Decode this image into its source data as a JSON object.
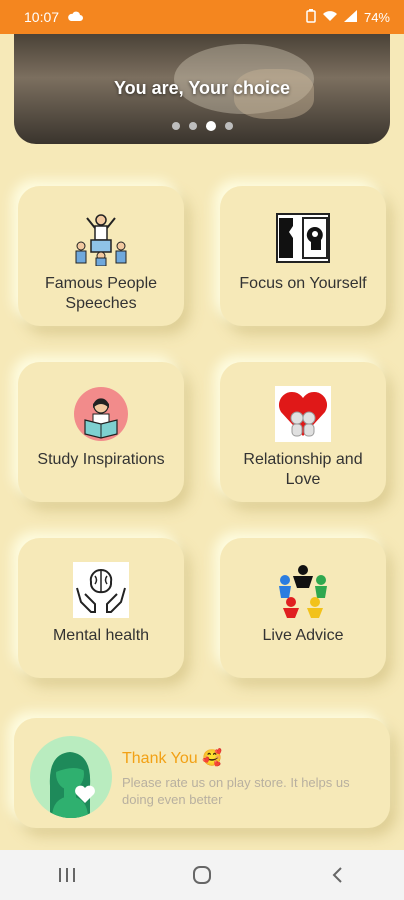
{
  "status": {
    "time": "10:07",
    "battery": "74%"
  },
  "banner": {
    "caption": "You are, Your choice",
    "dot_count": 4,
    "active_dot": 2
  },
  "categories": [
    {
      "label": "Famous People Speeches",
      "icon": "people-speech-icon"
    },
    {
      "label": "Focus on Yourself",
      "icon": "focus-self-icon"
    },
    {
      "label": "Study Inspirations",
      "icon": "study-icon"
    },
    {
      "label": "Relationship and Love",
      "icon": "love-icon"
    },
    {
      "label": "Mental health",
      "icon": "mental-health-icon"
    },
    {
      "label": "Live Advice",
      "icon": "live-advice-icon"
    }
  ],
  "thanks": {
    "title": "Thank You 🥰",
    "message": "Please rate us on play store. It helps us doing even better"
  },
  "colors": {
    "status_bar": "#f4861f",
    "background": "#f6e9b8",
    "accent": "#f2a115"
  }
}
